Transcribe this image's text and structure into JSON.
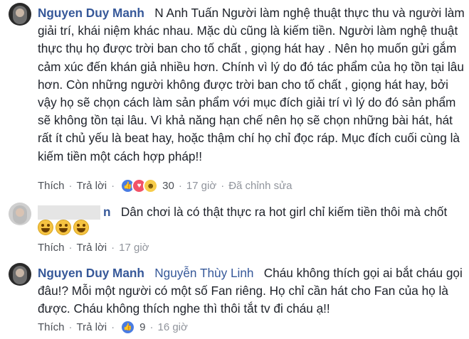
{
  "comments": [
    {
      "author": "Nguyen Duy Manh",
      "text": "N Anh Tuấn Người làm nghệ thuật thực thu và người làm giải trí, khái niệm khác nhau. Mặc dù cũng là kiếm tiền. Người làm nghệ thuật thực thụ họ được trời ban cho tố chất , giọng hát hay . Nên họ muốn gửi gắm cảm xúc đến khán giả nhiều hơn. Chính vì lý do đó tác phẩm của họ tồn tại lâu hơn. Còn những người không được trời ban cho tố chất , giọng hát hay, bởi vậy họ sẽ chọn cách làm sản phẩm với mục đích giải trí vì lý do đó sản phẩm sẽ không tồn tại lâu. Vì khả năng hạn chế nên họ sẽ chọn những bài hát, hát rất ít chủ yếu là beat hay, hoặc thậm chí họ chỉ đọc ráp. Mục đích cuối cùng là kiếm tiền một cách hợp pháp!!",
      "like_label": "Thích",
      "reply_label": "Trả lời",
      "reaction_count": "30",
      "reaction_icons": [
        "like-icon",
        "love-icon",
        "haha-icon"
      ],
      "time": "17 giờ",
      "edited": "Đã chỉnh sửa"
    },
    {
      "author_partial": "n",
      "text": "Dân chơi là có thật thực ra hot girl chỉ kiếm tiền thôi mà chốt",
      "emoji_icons": [
        "laughing-emoji",
        "laughing-emoji",
        "laughing-emoji"
      ],
      "like_label": "Thích",
      "reply_label": "Trả lời",
      "time": "17 giờ"
    },
    {
      "author": "Nguyen Duy Manh",
      "mention": "Nguyễn Thùy Linh",
      "text": "Cháu không thích gọi ai bắt cháu gọi đâu!? Mỗi một người có một số Fan riêng. Họ chỉ cần hát cho Fan của họ là được. Cháu không thích nghe thì thôi tắt tv đi cháu ạ!!",
      "like_label": "Thích",
      "reply_label": "Trả lời",
      "reaction_count": "9",
      "reaction_icons": [
        "like-icon"
      ],
      "time": "16 giờ"
    }
  ],
  "colors": {
    "link": "#365899",
    "text": "#1d2129",
    "action": "#4b4f56",
    "muted": "#90949c",
    "like": "#4a7ce2",
    "love": "#f25268",
    "haha": "#f7cc4a"
  }
}
